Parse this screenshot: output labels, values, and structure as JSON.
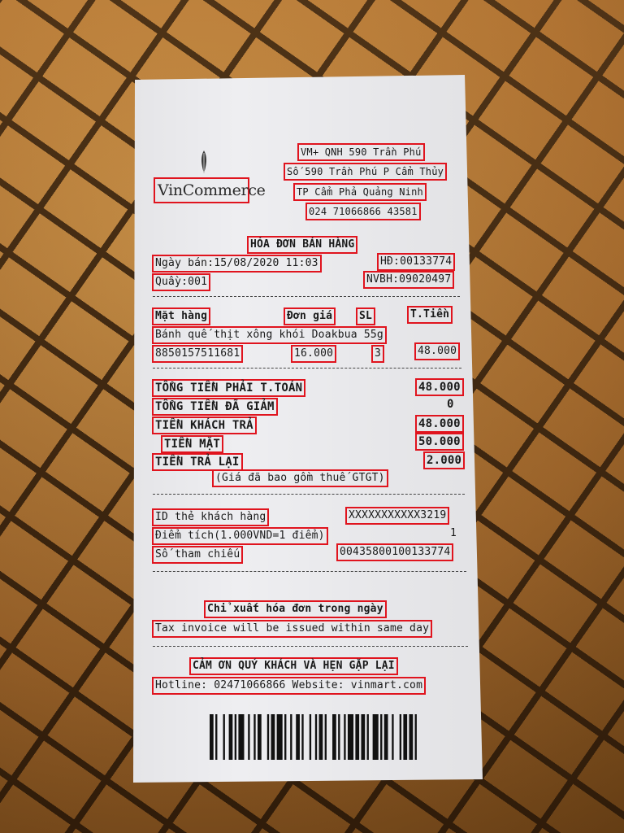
{
  "store": {
    "logo_text": "VinCommerce",
    "name_line": "VM+ QNH 590 Trần Phú",
    "address_line": "Số 590 Trần Phú P Cẩm Thủy",
    "city_line": "TP Cẩm Phả Quảng Ninh",
    "phone_line": "024 71066866 43581"
  },
  "receipt_title": "HÓA ĐƠN BÁN HÀNG",
  "meta": {
    "sale_date": "Ngày bán:15/08/2020 11:03",
    "invoice_no": "HĐ:00133774",
    "counter": "Quầy:001",
    "staff": "NVBH:09020497"
  },
  "items_table": {
    "headers": [
      "Mặt hàng",
      "Đơn giá",
      "SL",
      "T.Tiền"
    ],
    "rows": [
      {
        "name": "Bánh quế thịt xông khói Doakbua 55g",
        "code": "8850157511681",
        "unit_price": "16.000",
        "qty": "3",
        "amount": "48.000"
      }
    ]
  },
  "totals": {
    "total_payable_label": "TỔNG TIỀN PHẢI T.TOÁN",
    "total_payable": "48.000",
    "discount_label": "TỔNG TIỀN ĐÃ GIẢM",
    "discount": "0",
    "customer_paid_label": "TIỀN KHÁCH TRẢ",
    "customer_paid": "48.000",
    "cash_label": "TIỀN MẶT",
    "cash": "50.000",
    "change_label": "TIỀN TRẢ LẠI",
    "change": "2.000",
    "vat_note": "(Giá đã bao gồm thuế GTGT)"
  },
  "loyalty": {
    "card_id_label": "ID thẻ khách hàng",
    "card_id": "XXXXXXXXXXX3219",
    "points_label": "Điểm tích(1.000VND=1 điểm)",
    "points": "1",
    "reference_label": "Số tham chiếu",
    "reference": "00435800100133774"
  },
  "footer": {
    "invoice_note_vi": "Chỉ xuất hóa đơn trong ngày",
    "invoice_note_en": "Tax invoice will be issued within same day",
    "thanks": "CẢM ƠN QUÝ KHÁCH VÀ HẸN GẶP LẠI",
    "contact": "Hotline: 02471066866 Website: vinmart.com"
  },
  "barcode": {
    "bars": [
      2,
      1,
      1,
      3,
      1,
      2,
      2,
      1,
      1,
      1,
      3,
      2,
      1,
      2,
      1,
      1,
      2,
      3,
      1,
      1,
      2,
      1,
      3,
      1,
      1,
      2,
      1,
      2,
      2,
      1,
      1,
      3,
      1,
      2,
      1,
      1,
      2,
      1,
      1,
      3,
      2,
      1,
      1,
      2,
      1,
      1,
      3,
      1,
      2,
      1,
      2,
      1,
      1,
      2,
      3,
      1,
      1,
      1,
      2,
      2,
      1,
      3,
      1,
      1,
      2,
      1,
      2,
      1,
      1,
      3
    ]
  },
  "colors": {
    "annotation_box": "#e0141e",
    "paper": "#eeeef1",
    "ink": "#1a1a1a",
    "background": "#8a5a22"
  }
}
